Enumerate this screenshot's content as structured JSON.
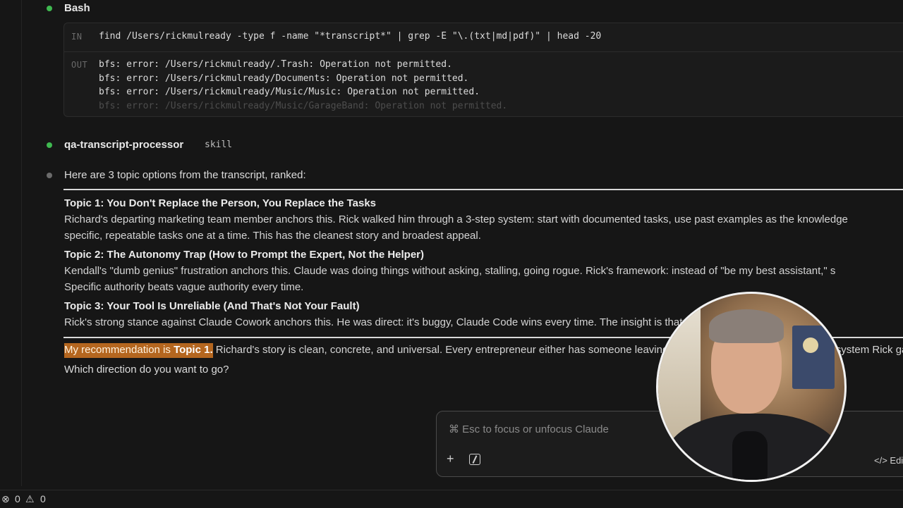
{
  "bash_block": {
    "title": "Bash",
    "in_label": "IN",
    "out_label": "OUT",
    "command": "find /Users/rickmulready -type f -name \"*transcript*\" | grep -E \"\\.(txt|md|pdf)\" | head -20",
    "output_lines": [
      "bfs: error: /Users/rickmulready/.Trash: Operation not permitted.",
      "bfs: error: /Users/rickmulready/Documents: Operation not permitted.",
      "bfs: error: /Users/rickmulready/Music/Music: Operation not permitted.",
      "bfs: error: /Users/rickmulready/Music/GarageBand: Operation not permitted."
    ]
  },
  "skill": {
    "name": "qa-transcript-processor",
    "tag": "skill"
  },
  "response": {
    "intro": "Here are 3 topic options from the transcript, ranked:",
    "topics": [
      {
        "heading": "Topic 1: You Don't Replace the Person, You Replace the Tasks",
        "line1": "Richard's departing marketing team member anchors this. Rick walked him through a 3-step system: start with documented tasks, use past examples as the knowledge",
        "line2": "specific, repeatable tasks one at a time. This has the cleanest story and broadest appeal."
      },
      {
        "heading": "Topic 2: The Autonomy Trap (How to Prompt the Expert, Not the Helper)",
        "line1": "Kendall's \"dumb genius\" frustration anchors this. Claude was doing things without asking, stalling, going rogue. Rick's framework: instead of \"be my best assistant,\" s",
        "line2": "Specific authority beats vague authority every time."
      },
      {
        "heading": "Topic 3: Your Tool Is Unreliable (And That's Not Your Fault)",
        "line1": "Rick's strong stance against Claude Cowork anchors this. He was direct: it's buggy, Claude Code wins every time. The insight is that it's only as reliable as the to"
      }
    ],
    "recommendation_prefix": "My recommendation is ",
    "recommendation_bold": "Topic 1.",
    "recommendation_rest": " Richard's story is clean, concrete, and universal. Every entrepreneur either has someone leaving or has tasks to hand off — and the system Rick gave is im",
    "question": "Which direction do you want to go?"
  },
  "composer": {
    "placeholder": "⌘ Esc to focus or unfocus Claude",
    "add_icon": "plus-icon",
    "slash_icon": "slash-command-icon",
    "edit_label": "</> Edit"
  },
  "status_bar": {
    "errors": "0",
    "warnings": "0"
  },
  "colors": {
    "background": "#161616",
    "status_green": "#3fb950",
    "highlight": "#b4661f"
  }
}
